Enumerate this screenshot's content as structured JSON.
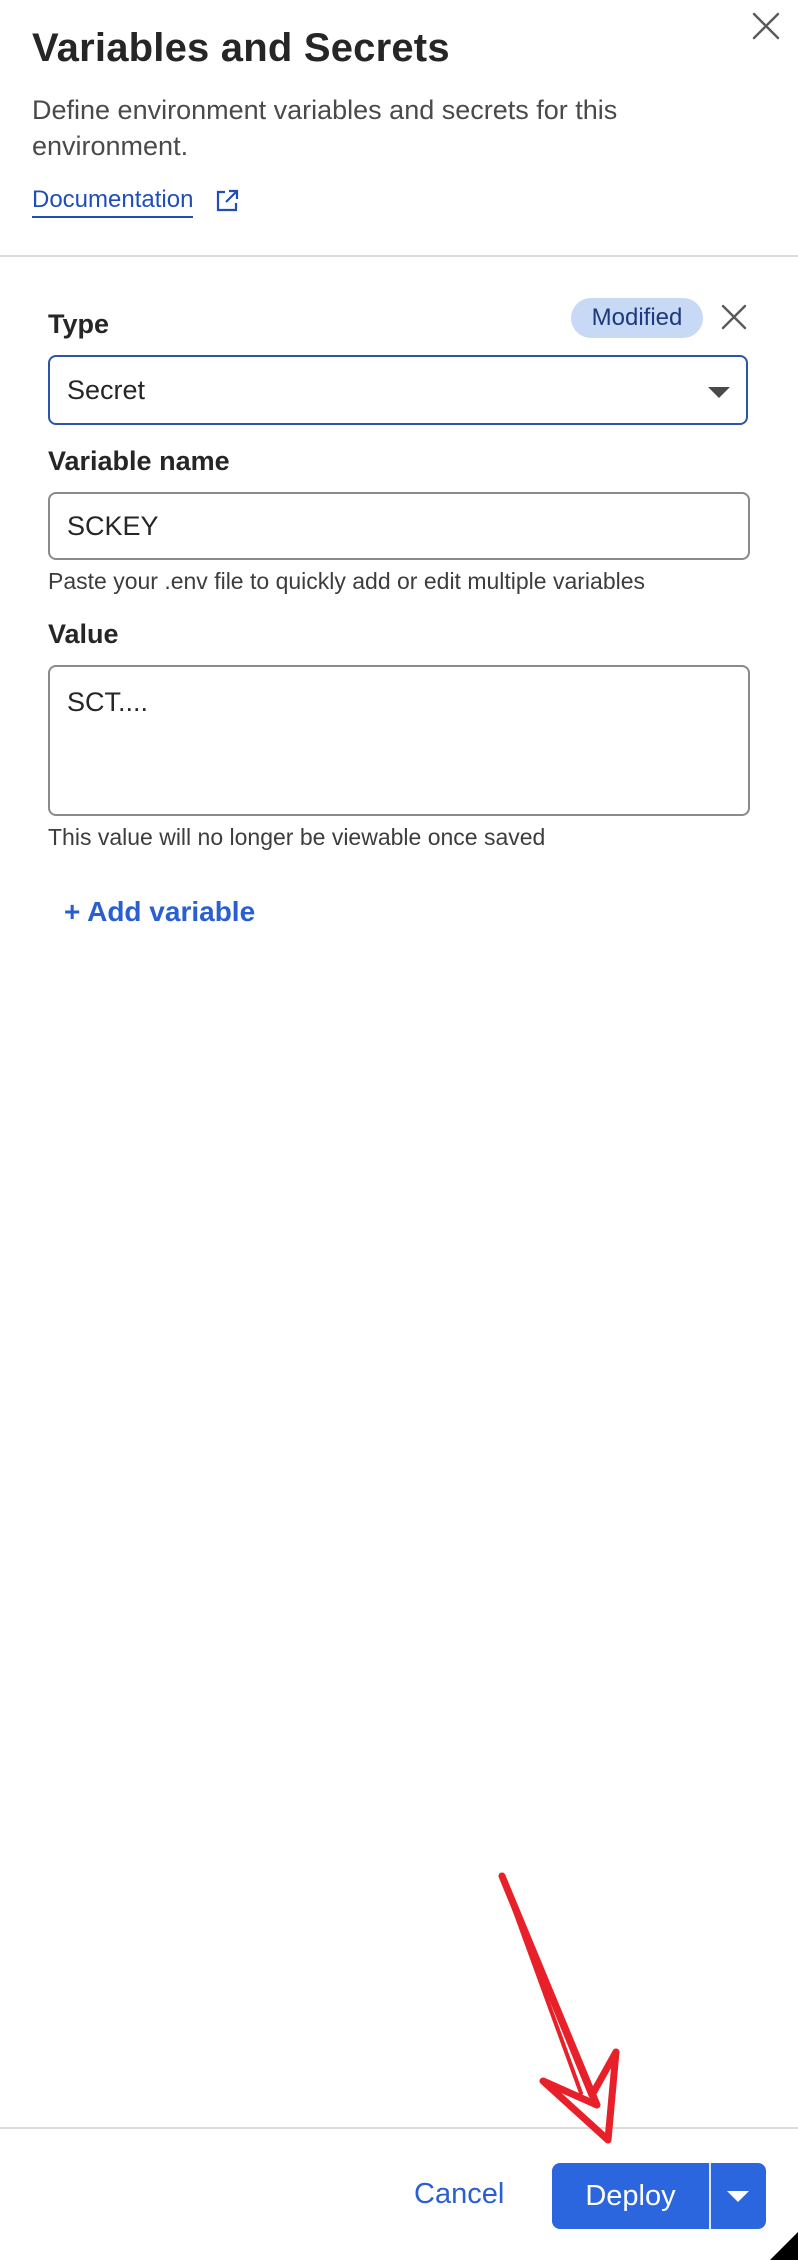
{
  "header": {
    "title": "Variables and Secrets",
    "description": "Define environment variables and secrets for this environment.",
    "doc_link": "Documentation"
  },
  "variable": {
    "status_badge": "Modified",
    "type_label": "Type",
    "type_value": "Secret",
    "name_label": "Variable name",
    "name_value": "SCKEY",
    "name_hint": "Paste your .env file to quickly add or edit multiple variables",
    "value_label": "Value",
    "value_value": "SCT....",
    "value_hint": "This value will no longer be viewable once saved"
  },
  "actions": {
    "add_variable": "+ Add variable",
    "cancel": "Cancel",
    "deploy": "Deploy"
  },
  "colors": {
    "accent": "#2b66df",
    "link": "#1f4fb6",
    "badge_bg": "#c8d9f6",
    "annotation_arrow": "#e8202a"
  },
  "icons": {
    "close": "close-icon",
    "external_link": "external-link-icon",
    "chevron": "chevron-down-icon"
  }
}
